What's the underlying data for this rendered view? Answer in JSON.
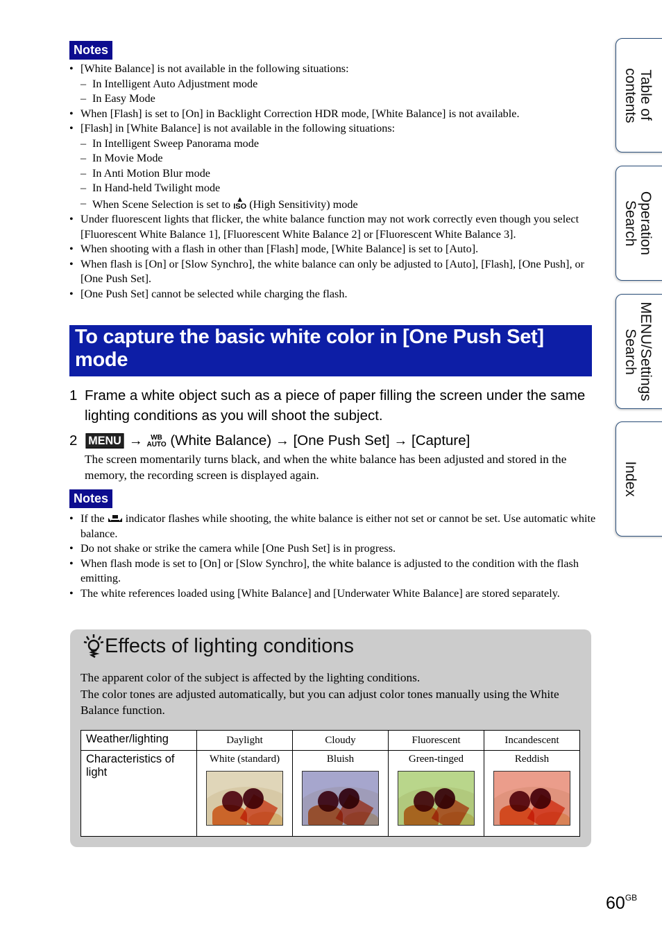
{
  "notes_top": {
    "badge": "Notes",
    "items": [
      {
        "text": "[White Balance] is not available in the following situations:",
        "sub": [
          "In Intelligent Auto Adjustment mode",
          "In Easy Mode"
        ]
      },
      {
        "text": "When [Flash] is set to [On] in Backlight Correction HDR mode, [White Balance] is not available.",
        "sub": []
      },
      {
        "text": "[Flash] in [White Balance] is not available in the following situations:",
        "sub": [
          "In Intelligent Sweep Panorama mode",
          "In Movie Mode",
          "In Anti Motion Blur mode",
          "In Hand-held Twilight mode"
        ]
      },
      {
        "text": "Under fluorescent lights that flicker, the white balance function may not work correctly even though you select [Fluorescent White Balance 1], [Fluorescent White Balance 2] or [Fluorescent White Balance 3].",
        "sub": []
      },
      {
        "text": "When shooting with a flash in other than [Flash] mode, [White Balance] is set to [Auto].",
        "sub": []
      },
      {
        "text": "When flash is [On] or [Slow Synchro], the white balance can only be adjusted to [Auto], [Flash], [One Push], or [One Push Set].",
        "sub": []
      },
      {
        "text": "[One Push Set] cannot be selected while charging the flash.",
        "sub": []
      }
    ],
    "scene_sub": {
      "before": "When Scene Selection is set to ",
      "icon": "ISO",
      "after": " (High Sensitivity) mode"
    }
  },
  "section": {
    "title": "To capture the basic white color in [One Push Set] mode"
  },
  "steps": [
    {
      "num": "1",
      "text": "Frame a white object such as a piece of paper filling the screen under the same lighting conditions as you will shoot the subject."
    },
    {
      "num": "2",
      "menu_icon": "MENU",
      "wb_icon_top": "WB",
      "wb_icon_bottom": "AUTO",
      "arrow": "→",
      "part1": "(White Balance)",
      "part2": "[One Push Set]",
      "part3": "[Capture]",
      "desc": "The screen momentarily turns black, and when the white balance has been adjusted and stored in the memory, the recording screen is displayed again."
    }
  ],
  "notes_bottom": {
    "badge": "Notes",
    "first": {
      "before": "If the ",
      "after": " indicator flashes while shooting, the white balance is either not set or cannot be set. Use automatic white balance."
    },
    "items": [
      "Do not shake or strike the camera while [One Push Set] is in progress.",
      "When flash mode is set to [On] or [Slow Synchro], the white balance is adjusted to the condition with the flash emitting.",
      "The white references loaded using [White Balance] and [Underwater White Balance] are stored separately."
    ]
  },
  "tips": {
    "title": "Effects of lighting conditions",
    "para1": "The apparent color of the subject is affected by the lighting conditions.",
    "para2": "The color tones are adjusted automatically, but you can adjust color tones manually using the White Balance function.",
    "table": {
      "row1_header": "Weather/lighting",
      "row2_header": "Characteristics of light",
      "columns": [
        {
          "lighting": "Daylight",
          "characteristic": "White (standard)",
          "tint": "#e8e0c8"
        },
        {
          "lighting": "Cloudy",
          "characteristic": "Bluish",
          "tint": "#b8b8d8"
        },
        {
          "lighting": "Fluorescent",
          "characteristic": "Green-tinged",
          "tint": "#c8e0a0"
        },
        {
          "lighting": "Incandescent",
          "characteristic": "Reddish",
          "tint": "#f0b0a0"
        }
      ]
    }
  },
  "side_tabs": [
    {
      "label": "Table of contents"
    },
    {
      "label": "Operation Search"
    },
    {
      "label": "MENU/Settings Search"
    },
    {
      "label": "Index"
    }
  ],
  "page": {
    "number": "60",
    "suffix": "GB"
  },
  "colors": {
    "notes_badge": "#0d0d8f",
    "section_header": "#0d1ea6",
    "tips_bg": "#cccccc",
    "tab_border": "#2b4f7a"
  }
}
